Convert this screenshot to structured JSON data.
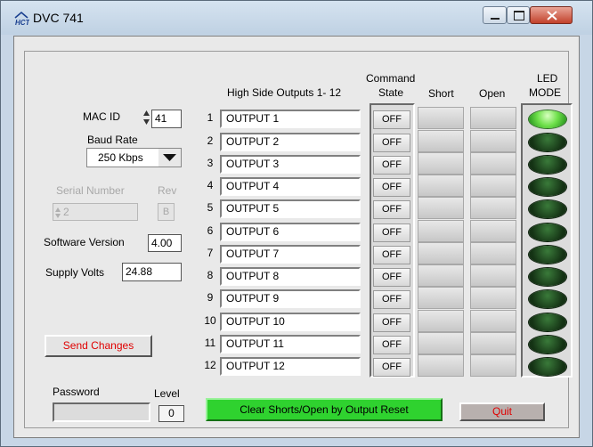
{
  "window": {
    "title": "DVC 741"
  },
  "left": {
    "mac_id_label": "MAC ID",
    "mac_id_value": "41",
    "baud_rate_label": "Baud Rate",
    "baud_rate_value": "250 Kbps",
    "serial_number_label": "Serial Number",
    "serial_number_value": "2",
    "rev_label": "Rev",
    "rev_value": "B",
    "software_version_label": "Software Version",
    "software_version_value": "4.00",
    "supply_volts_label": "Supply Volts",
    "supply_volts_value": "24.88",
    "send_changes_label": "Send Changes",
    "password_label": "Password",
    "level_label": "Level",
    "level_value": "0"
  },
  "table": {
    "outputs_header": "High Side Outputs  1- 12",
    "command_header": "Command",
    "state_header": "State",
    "short_header": "Short",
    "open_header": "Open",
    "led_header": "LED",
    "mode_header": "MODE",
    "rows": [
      {
        "num": "1",
        "name": "OUTPUT  1",
        "state": "OFF",
        "led_on": true
      },
      {
        "num": "2",
        "name": "OUTPUT  2",
        "state": "OFF",
        "led_on": false
      },
      {
        "num": "3",
        "name": "OUTPUT  3",
        "state": "OFF",
        "led_on": false
      },
      {
        "num": "4",
        "name": "OUTPUT  4",
        "state": "OFF",
        "led_on": false
      },
      {
        "num": "5",
        "name": "OUTPUT  5",
        "state": "OFF",
        "led_on": false
      },
      {
        "num": "6",
        "name": "OUTPUT  6",
        "state": "OFF",
        "led_on": false
      },
      {
        "num": "7",
        "name": "OUTPUT  7",
        "state": "OFF",
        "led_on": false
      },
      {
        "num": "8",
        "name": "OUTPUT  8",
        "state": "OFF",
        "led_on": false
      },
      {
        "num": "9",
        "name": "OUTPUT  9",
        "state": "OFF",
        "led_on": false
      },
      {
        "num": "10",
        "name": "OUTPUT  10",
        "state": "OFF",
        "led_on": false
      },
      {
        "num": "11",
        "name": "OUTPUT  11",
        "state": "OFF",
        "led_on": false
      },
      {
        "num": "12",
        "name": "OUTPUT  12",
        "state": "OFF",
        "led_on": false
      }
    ]
  },
  "bottom": {
    "clear_button_label": "Clear Shorts/Open by Output Reset",
    "quit_label": "Quit"
  },
  "colors": {
    "led_on": "#6ee04a",
    "led_off": "#143214",
    "send_changes_text": "#e00000",
    "clear_button_bg": "#2fd22f",
    "quit_bg": "#b8b0ae"
  }
}
